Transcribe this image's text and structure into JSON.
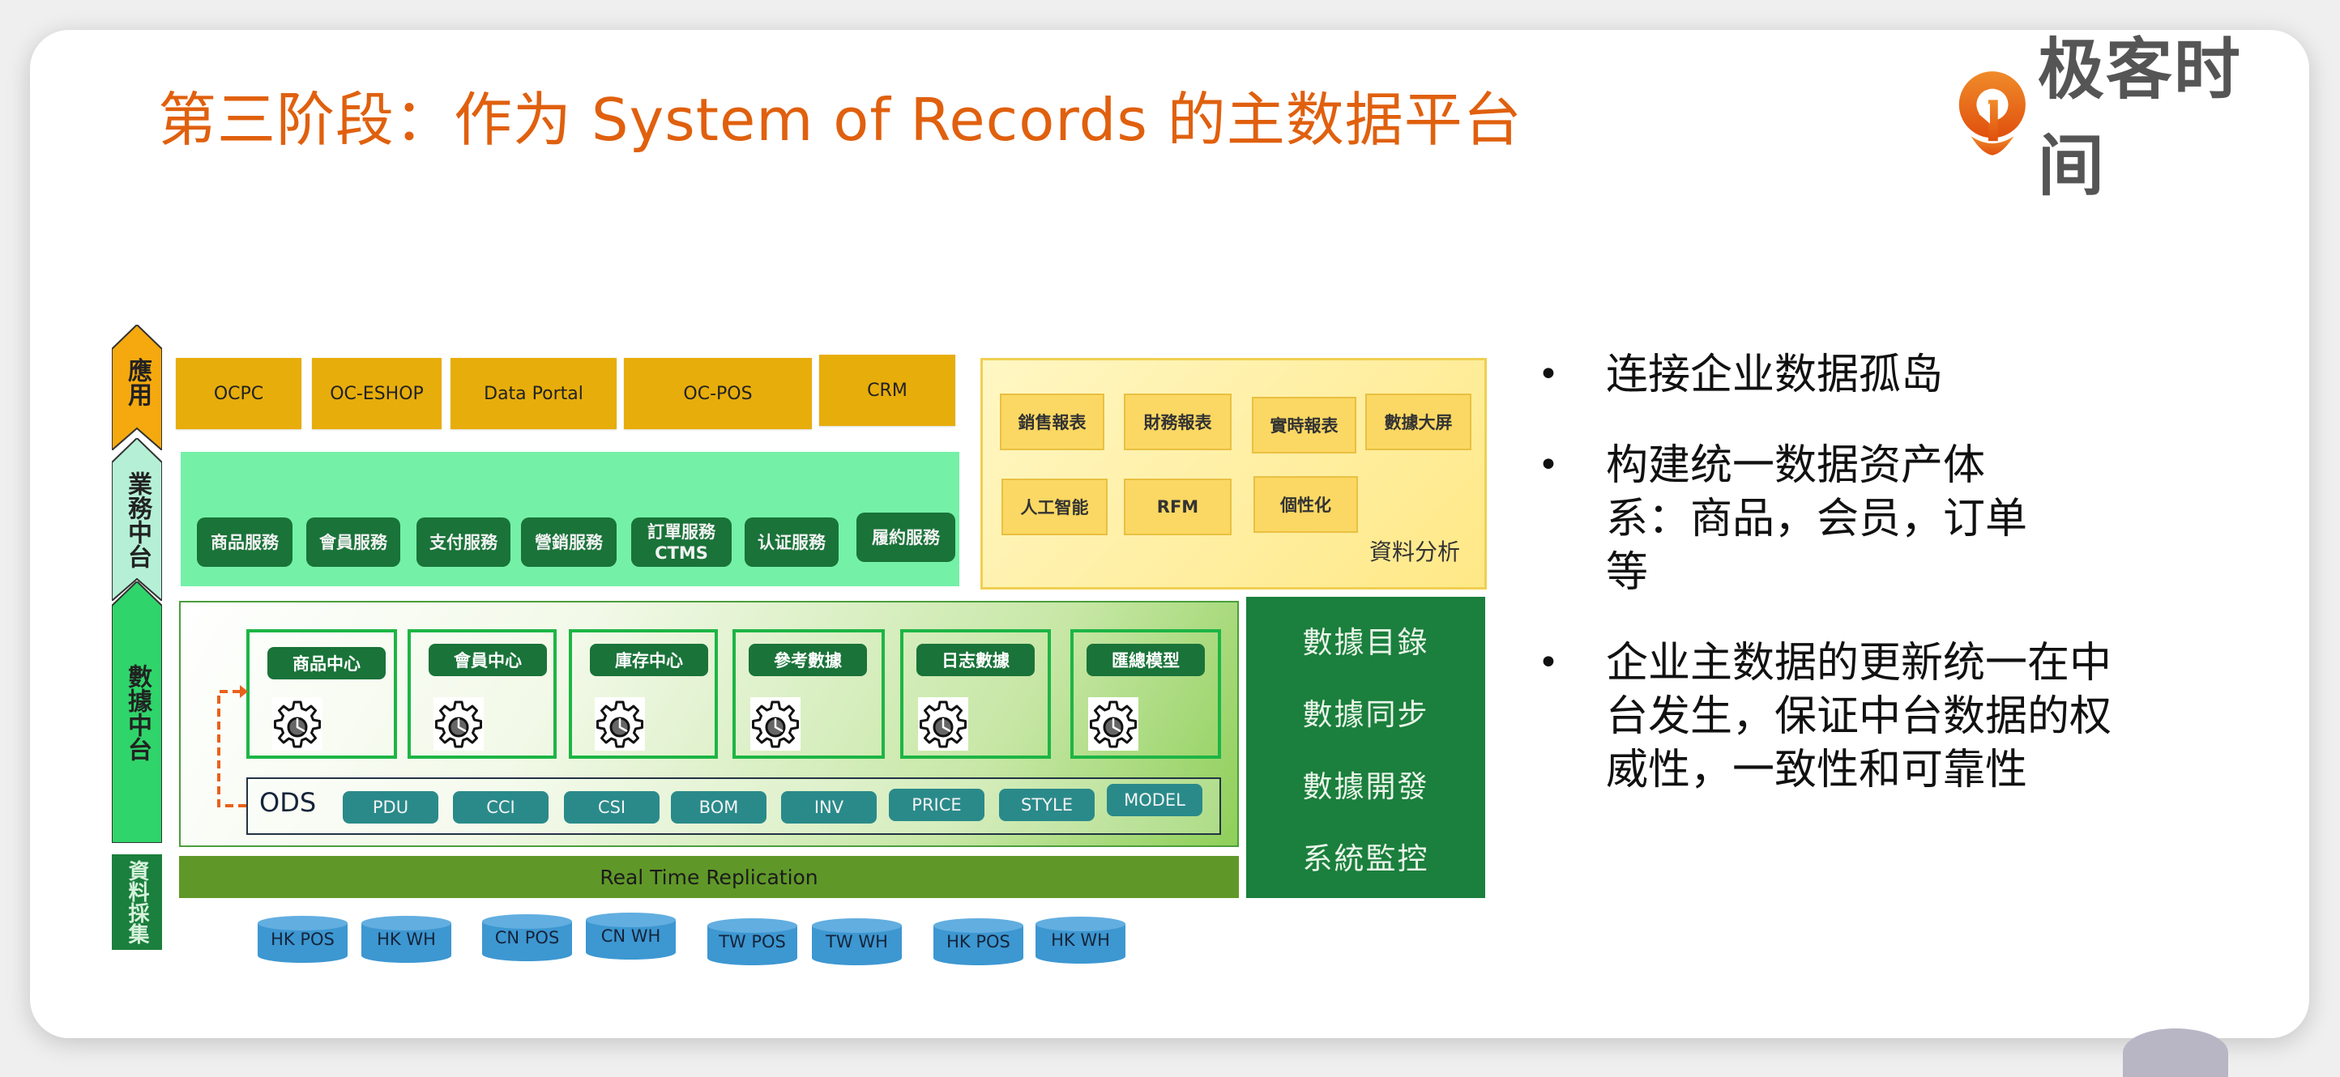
{
  "title": "第三阶段：作为 System of Records 的主数据平台",
  "logo": {
    "text": "极客时间",
    "icon": "geekbang-logo-icon",
    "brand_color": "#e8621a"
  },
  "stages": [
    {
      "label": "應用",
      "color": "#f5a90f"
    },
    {
      "label": "業務中台",
      "color": "#b5f0d6"
    },
    {
      "label": "數據中台",
      "color": "#2fd56a"
    },
    {
      "label": "資料採集",
      "color": "#1b7f3d"
    }
  ],
  "applications": [
    "OCPC",
    "OC-ESHOP",
    "Data Portal",
    "OC-POS",
    "CRM"
  ],
  "business_services": [
    "商品服務",
    "會員服務",
    "支付服務",
    "營銷服務",
    "訂單服務 CTMS",
    "认证服務",
    "履約服務"
  ],
  "analysis": {
    "label": "資料分析",
    "items": [
      "銷售報表",
      "財務報表",
      "實時報表",
      "數據大屏",
      "人工智能",
      "RFM",
      "個性化"
    ]
  },
  "data_centers": [
    "商品中心",
    "會員中心",
    "庫存中心",
    "參考數據",
    "日志數據",
    "匯總模型"
  ],
  "ods": {
    "label": "ODS",
    "chips": [
      "PDU",
      "CCI",
      "CSI",
      "BOM",
      "INV",
      "PRICE",
      "STYLE",
      "MODEL"
    ]
  },
  "management": [
    "數據目錄",
    "數據同步",
    "數據開發",
    "系統監控"
  ],
  "replication": "Real Time Replication",
  "sources": [
    "HK POS",
    "HK WH",
    "CN  POS",
    "CN WH",
    "TW POS",
    "TW WH",
    "HK POS",
    "HK WH"
  ],
  "bullets": [
    "连接企业数据孤岛",
    "构建统一数据资产体系：商品，会员，订单等",
    "企业主数据的更新统一在中台发生，保证中台数据的权威性，一致性和可靠性"
  ],
  "bullet_symbol": "•"
}
